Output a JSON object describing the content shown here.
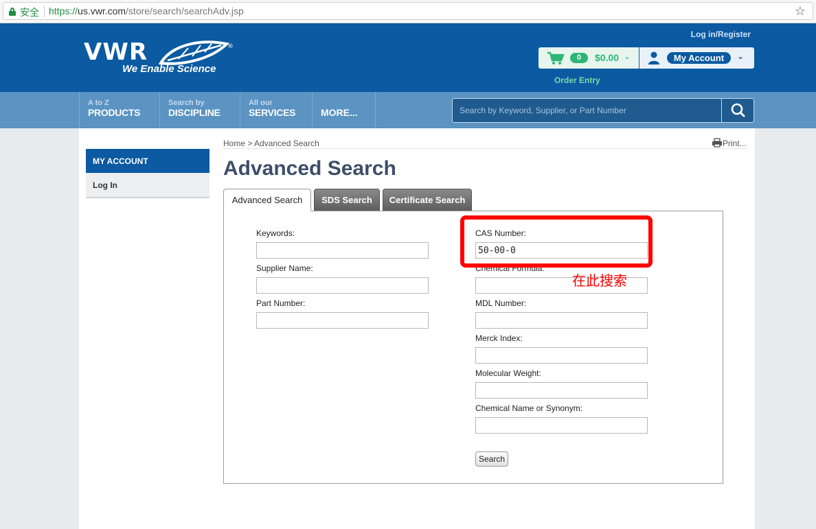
{
  "browser": {
    "secure_label": "安全",
    "url_scheme": "https://",
    "url_host": "us.vwr.com",
    "url_path": "/store/search/searchAdv.jsp"
  },
  "header": {
    "logo_word": "VWR",
    "logo_tagline": "We Enable Science",
    "login_link": "Log in/Register",
    "cart_count": "0",
    "cart_total": "$0.00",
    "account_label": "My Account",
    "order_entry": "Order Entry",
    "brand_color": "#0b5aa2",
    "accent_color": "#2bb673"
  },
  "nav": {
    "items": [
      {
        "small": "A to Z",
        "big": "PRODUCTS"
      },
      {
        "small": "Search by",
        "big": "DISCIPLINE"
      },
      {
        "small": "All our",
        "big": "SERVICES"
      },
      {
        "small": "",
        "big": "MORE..."
      }
    ],
    "search_placeholder": "Search by Keyword, Supplier, or Part Number"
  },
  "sidebar": {
    "heading": "MY ACCOUNT",
    "items": [
      "Log In"
    ]
  },
  "main": {
    "breadcrumb_home": "Home",
    "breadcrumb_current": "Advanced Search",
    "print_label": "Print...",
    "title": "Advanced Search",
    "tabs": [
      {
        "label": "Advanced Search",
        "active": true
      },
      {
        "label": "SDS Search",
        "active": false
      },
      {
        "label": "Certificate Search",
        "active": false
      }
    ],
    "left_fields": [
      {
        "label": "Keywords:",
        "value": ""
      },
      {
        "label": "Supplier Name:",
        "value": ""
      },
      {
        "label": "Part Number:",
        "value": ""
      }
    ],
    "right_fields": [
      {
        "label": "CAS Number:",
        "value": "50-00-0"
      },
      {
        "label": "Chemical Formula:",
        "value": ""
      },
      {
        "label": "MDL Number:",
        "value": ""
      },
      {
        "label": "Merck Index:",
        "value": ""
      },
      {
        "label": "Molecular Weight:",
        "value": ""
      },
      {
        "label": "Chemical Name or Synonym:",
        "value": ""
      }
    ],
    "search_button": "Search"
  },
  "annotation": {
    "text": "在此搜索",
    "color": "#ff0000"
  }
}
